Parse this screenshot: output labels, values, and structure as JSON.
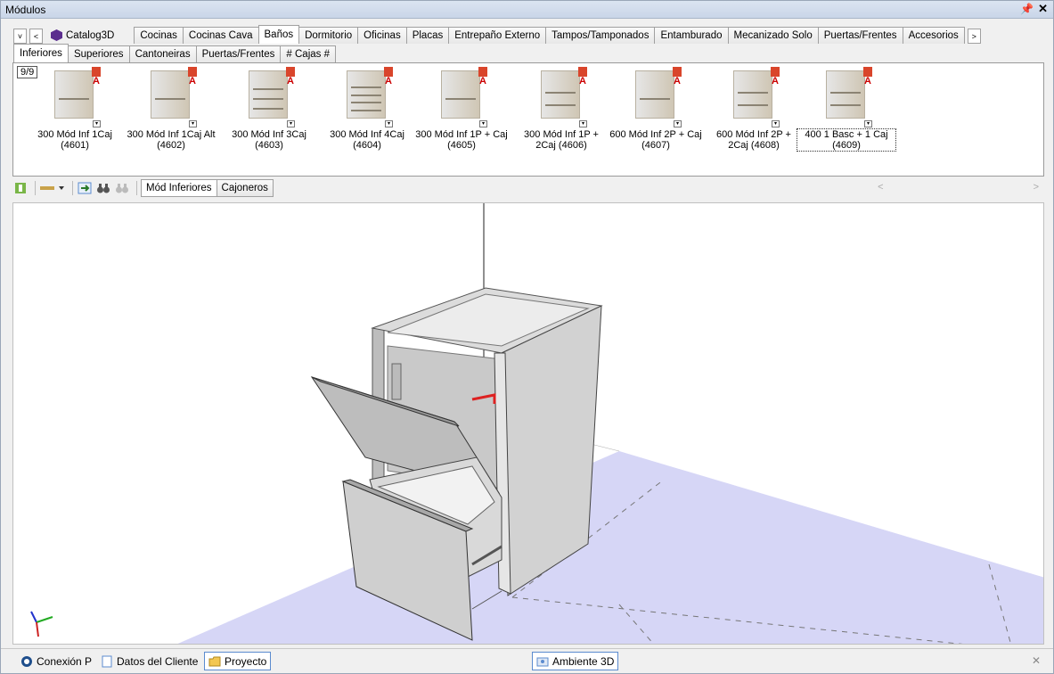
{
  "window": {
    "title": "Módulos",
    "pin": "I",
    "close": "✕"
  },
  "category_tabs": {
    "nav_down": "˅",
    "nav_left": "<",
    "nav_right": ">",
    "items": [
      "Catalog3D",
      "Cocinas",
      "Cocinas Cava",
      "Baños",
      "Dormitorio",
      "Oficinas",
      "Placas",
      "Entrepaño Externo",
      "Tampos/Tamponados",
      "Entamburado",
      "Mecanizado Solo",
      "Puertas/Frentes",
      "Accesorios"
    ],
    "active": "Baños"
  },
  "sub_tabs": {
    "items": [
      "Inferiores",
      "Superiores",
      "Cantoneiras",
      "Puertas/Frentes",
      "# Cajas #"
    ],
    "active": "Inferiores"
  },
  "gallery": {
    "count": "9/9",
    "items": [
      {
        "line1": "300 Mód Inf 1Caj",
        "line2": "(4601)",
        "lines": 1
      },
      {
        "line1": "300 Mód Inf 1Caj Alt",
        "line2": "(4602)",
        "lines": 1
      },
      {
        "line1": "300 Mód Inf 3Caj",
        "line2": "(4603)",
        "lines": 3
      },
      {
        "line1": "300 Mód Inf 4Caj",
        "line2": "(4604)",
        "lines": 4
      },
      {
        "line1": "300 Mód Inf 1P + Caj",
        "line2": "(4605)",
        "lines": 1
      },
      {
        "line1": "300 Mód Inf 1P +",
        "line2": "2Caj (4606)",
        "lines": 2
      },
      {
        "line1": "600 Mód Inf 2P + Caj",
        "line2": "(4607)",
        "lines": 1
      },
      {
        "line1": "600 Mód Inf 2P +",
        "line2": "2Caj (4608)",
        "lines": 2
      },
      {
        "line1": "400 1 Basc + 1 Caj",
        "line2": "(4609)",
        "lines": 2
      }
    ],
    "selected_index": 8
  },
  "view_toolbar": {
    "tabs": [
      "Mód Inferiores",
      "Cajoneros"
    ],
    "active": "Mód Inferiores",
    "scroll_left": "<",
    "scroll_right": ">"
  },
  "statusbar": {
    "items": [
      "Conexión P",
      "Datos del Cliente",
      "Proyecto"
    ],
    "center": "Ambiente 3D",
    "close": "✕"
  },
  "colors": {
    "floor": "#d9d9f7",
    "accent": "#5b8bcf"
  }
}
